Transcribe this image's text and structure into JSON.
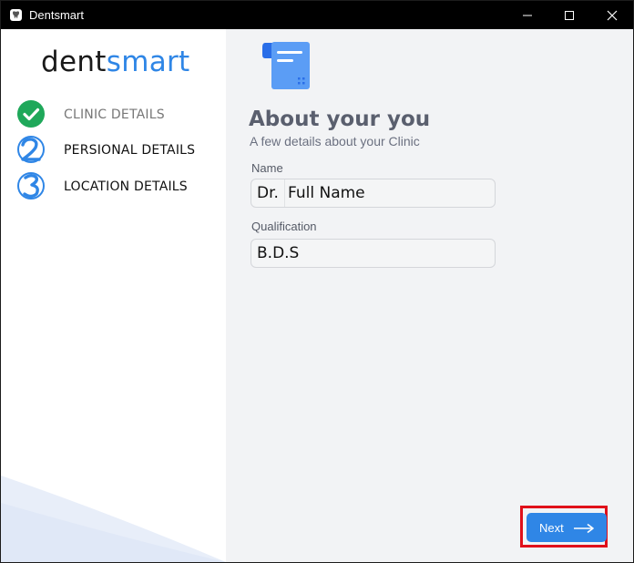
{
  "window": {
    "title": "Dentsmart"
  },
  "sidebar": {
    "logo_dark": "dent",
    "logo_blue": "smart",
    "steps": [
      {
        "label": "CLINIC DETAILS",
        "state": "completed",
        "icon": "check-circle-icon"
      },
      {
        "label": "PERSIONAL DETAILS",
        "state": "current",
        "icon": "number-2-icon"
      },
      {
        "label": "LOCATION DETAILS",
        "state": "upcoming",
        "icon": "number-3-icon"
      }
    ]
  },
  "form": {
    "title": "About your you",
    "subtitle": "A few details about your Clinic",
    "name_label": "Name",
    "name_prefix": "Dr.",
    "name_value": "Full Name",
    "qualification_label": "Qualification",
    "qualification_value": "B.D.S",
    "next_label": "Next"
  },
  "colors": {
    "accent": "#2f86e6",
    "success": "#1fa85a",
    "highlight": "#e0101a"
  }
}
